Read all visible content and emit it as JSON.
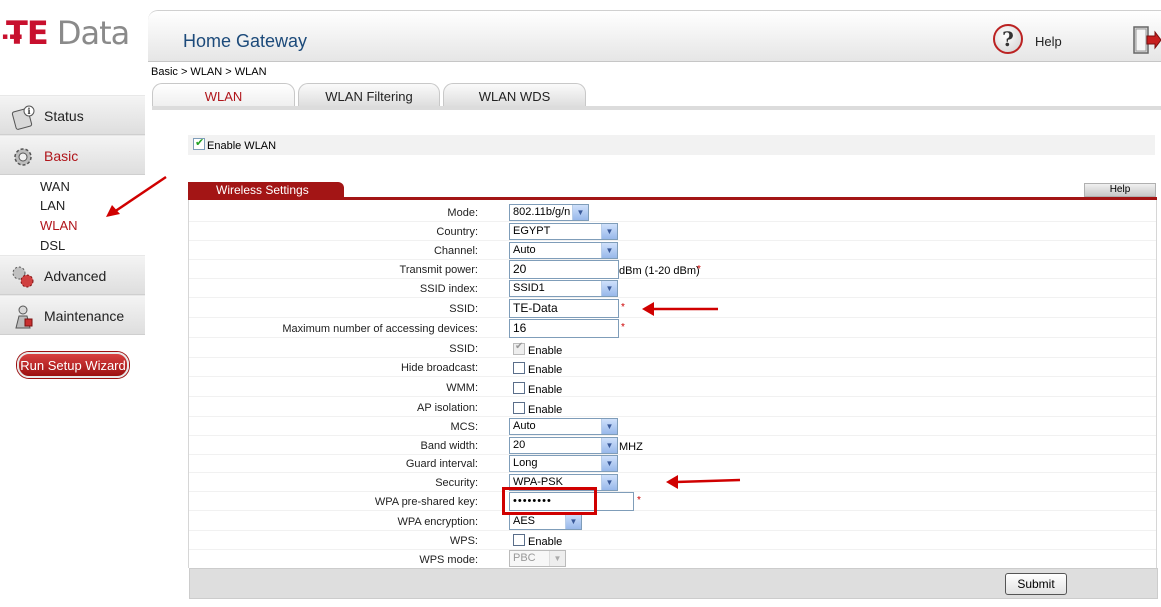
{
  "header": {
    "logo_te": "TE",
    "logo_data": "Data",
    "title": "Home Gateway",
    "help_label": "Help",
    "help_icon": "question-mark-icon",
    "logout_icon": "logout-door-icon"
  },
  "nav": {
    "groups": [
      {
        "label": "Status",
        "icon": "status-icon"
      },
      {
        "label": "Basic",
        "icon": "gear-icon"
      },
      {
        "label": "Advanced",
        "icon": "advanced-icon"
      },
      {
        "label": "Maintenance",
        "icon": "maintenance-icon"
      }
    ],
    "basic_items": [
      "WAN",
      "LAN",
      "WLAN",
      "DSL"
    ],
    "selected_item": "WLAN",
    "wizard_label": "Run Setup Wizard"
  },
  "breadcrumb": "Basic > WLAN > WLAN",
  "tabs": [
    "WLAN",
    "WLAN Filtering",
    "WLAN WDS"
  ],
  "active_tab": "WLAN",
  "enable_wlan": {
    "label": "Enable WLAN",
    "checked": true
  },
  "section": {
    "title": "Wireless Settings",
    "help_label": "Help"
  },
  "form": {
    "mode": {
      "label": "Mode:",
      "value": "802.11b/g/n"
    },
    "country": {
      "label": "Country:",
      "value": "EGYPT"
    },
    "channel": {
      "label": "Channel:",
      "value": "Auto"
    },
    "transmit_power": {
      "label": "Transmit power:",
      "value": "20",
      "unit": "dBm (1-20 dBm)",
      "required": "*"
    },
    "ssid_index": {
      "label": "SSID index:",
      "value": "SSID1"
    },
    "ssid": {
      "label": "SSID:",
      "value": "TE-Data",
      "required": "*"
    },
    "max_devices": {
      "label": "Maximum number of accessing devices:",
      "value": "16",
      "required": "*"
    },
    "ssid_enable": {
      "label": "SSID:",
      "option": "Enable",
      "checked": true,
      "disabled": true
    },
    "hide_broadcast": {
      "label": "Hide broadcast:",
      "option": "Enable",
      "checked": false
    },
    "wmm": {
      "label": "WMM:",
      "option": "Enable",
      "checked": false
    },
    "ap_isolation": {
      "label": "AP isolation:",
      "option": "Enable",
      "checked": false
    },
    "mcs": {
      "label": "MCS:",
      "value": "Auto"
    },
    "band_width": {
      "label": "Band width:",
      "value": "20",
      "unit": "MHZ"
    },
    "guard_interval": {
      "label": "Guard interval:",
      "value": "Long"
    },
    "security": {
      "label": "Security:",
      "value": "WPA-PSK"
    },
    "wpa_key": {
      "label": "WPA pre-shared key:",
      "value": "••••••••",
      "required": "*"
    },
    "wpa_encryption": {
      "label": "WPA encryption:",
      "value": "AES"
    },
    "wps": {
      "label": "WPS:",
      "option": "Enable",
      "checked": false
    },
    "wps_mode": {
      "label": "WPS mode:",
      "value": "PBC",
      "disabled": true
    }
  },
  "submit_label": "Submit",
  "colors": {
    "brand_red": "#a31515",
    "annotation_red": "#d00000",
    "title_blue": "#1c4a7a"
  }
}
